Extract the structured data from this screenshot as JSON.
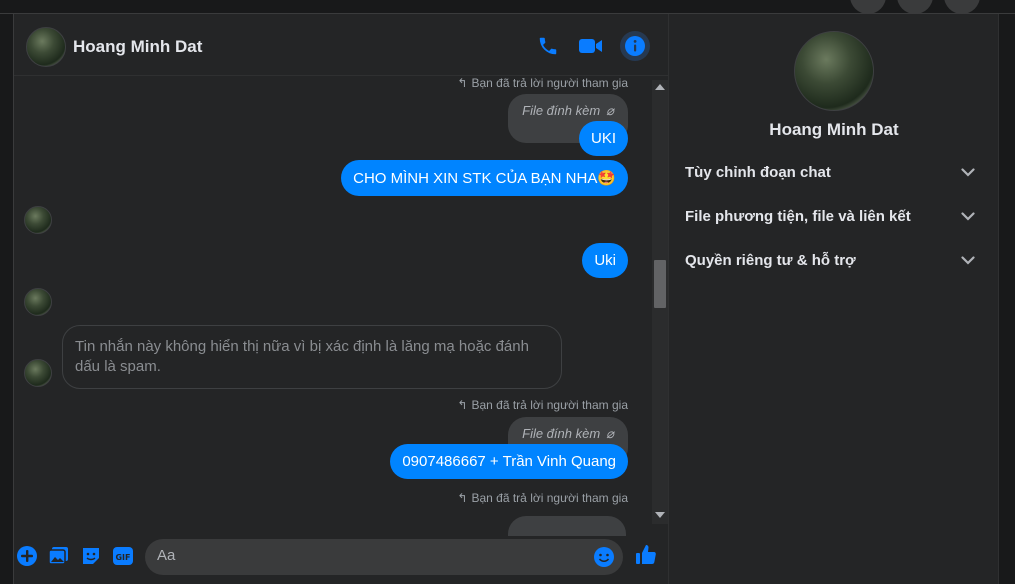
{
  "conversation": {
    "contact_name": "Hoang Minh Dat"
  },
  "header_icons": [
    "phone-icon",
    "video-camera-icon",
    "info-icon"
  ],
  "messages": {
    "reply_note": "Bạn đã trả lời người tham gia",
    "attachment_label": "File đính kèm",
    "uki_1": "UKI",
    "stk_request": "CHO MÌNH XIN STK CỦA BẠN NHA🤩",
    "uki_2": "Uki",
    "removed_notice": "Tin nhắn này không hiển thị nữa vì bị xác định là lăng mạ hoặc đánh dấu là spam.",
    "account_info": "0907486667 + Trần Vinh Quang"
  },
  "composer": {
    "placeholder": "Aa",
    "icons": [
      "add-icon",
      "image-icon",
      "sticker-icon",
      "gif-icon",
      "emoji-icon",
      "like-icon"
    ]
  },
  "info_panel": {
    "name": "Hoang Minh Dat",
    "sections": [
      "Tùy chỉnh đoạn chat",
      "File phương tiện, file và liên kết",
      "Quyền riêng tư & hỗ trợ"
    ]
  },
  "colors": {
    "accent": "#0084ff",
    "panel": "#242526",
    "background": "#18191a",
    "bubble_grey": "#3e4042"
  }
}
